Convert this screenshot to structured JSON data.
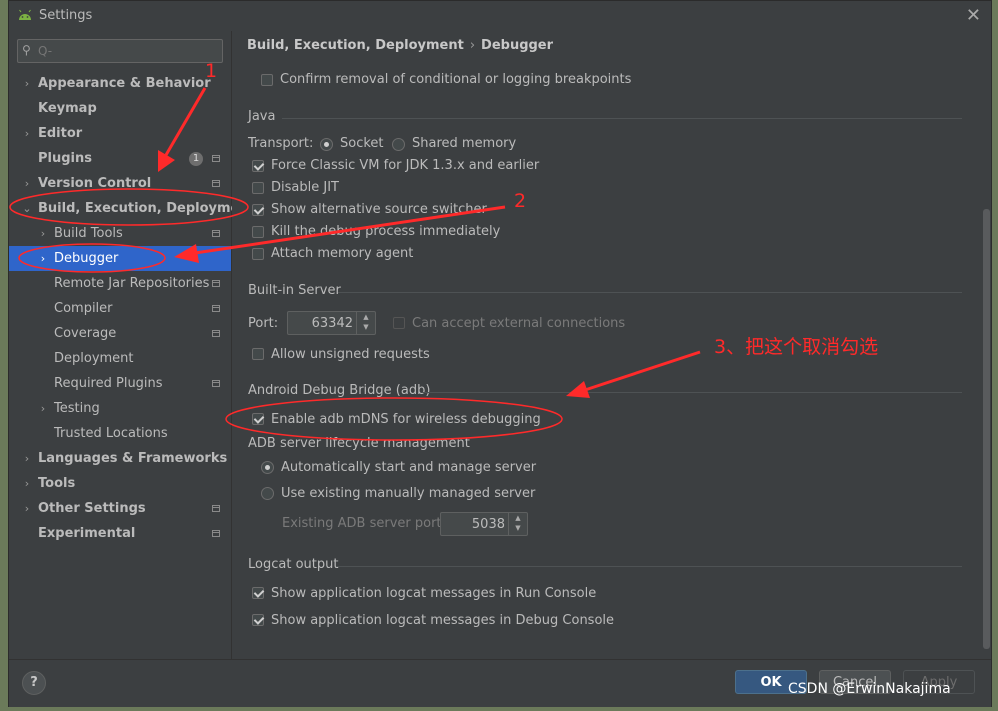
{
  "window": {
    "title": "Settings"
  },
  "search": {
    "placeholder": "Q-"
  },
  "sidebar": {
    "items": [
      {
        "label": "Appearance & Behavior",
        "arrow": "›",
        "bold": true
      },
      {
        "label": "Keymap",
        "bold": true
      },
      {
        "label": "Editor",
        "arrow": "›",
        "bold": true
      },
      {
        "label": "Plugins",
        "bold": true,
        "badge": "1"
      },
      {
        "label": "Version Control",
        "arrow": "›",
        "bold": true
      },
      {
        "label": "Build, Execution, Deployment",
        "arrow": "⌄",
        "bold": true
      },
      {
        "label": "Build Tools",
        "arrow": "›"
      },
      {
        "label": "Debugger",
        "arrow": "›",
        "selected": true
      },
      {
        "label": "Remote Jar Repositories"
      },
      {
        "label": "Compiler"
      },
      {
        "label": "Coverage"
      },
      {
        "label": "Deployment"
      },
      {
        "label": "Required Plugins"
      },
      {
        "label": "Testing",
        "arrow": "›"
      },
      {
        "label": "Trusted Locations"
      },
      {
        "label": "Languages & Frameworks",
        "arrow": "›",
        "bold": true
      },
      {
        "label": "Tools",
        "arrow": "›",
        "bold": true
      },
      {
        "label": "Other Settings",
        "arrow": "›",
        "bold": true
      },
      {
        "label": "Experimental",
        "bold": true
      }
    ]
  },
  "breadcrumb": {
    "parent": "Build, Execution, Deployment",
    "sep": "›",
    "current": "Debugger"
  },
  "main": {
    "confirm_removal": "Confirm removal of conditional or logging breakpoints",
    "java": {
      "title": "Java",
      "transport_label": "Transport:",
      "socket": "Socket",
      "shared_memory": "Shared memory",
      "force_classic": "Force Classic VM for JDK 1.3.x and earlier",
      "disable_jit": "Disable JIT",
      "show_alt": "Show alternative source switcher",
      "kill_debug": "Kill the debug process immediately",
      "attach_agent": "Attach memory agent"
    },
    "builtin": {
      "title": "Built-in Server",
      "port_label": "Port:",
      "port_value": "63342",
      "external": "Can accept external connections",
      "unsigned": "Allow unsigned requests"
    },
    "adb": {
      "title": "Android Debug Bridge (adb)",
      "mdns": "Enable adb mDNS for wireless debugging",
      "lifecycle": "ADB server lifecycle management",
      "auto": "Automatically start and manage server",
      "existing": "Use existing manually managed server",
      "port_label": "Existing ADB server port:",
      "port_value": "5038"
    },
    "logcat": {
      "title": "Logcat output",
      "run": "Show application logcat messages in Run Console",
      "debug": "Show application logcat messages in Debug Console"
    }
  },
  "footer": {
    "help": "?",
    "ok": "OK",
    "cancel": "Cancel",
    "apply": "Apply"
  },
  "annotations": {
    "one": "1",
    "two": "2",
    "three": "3、把这个取消勾选"
  },
  "watermark": "CSDN @ErwinNakajima",
  "colors": {
    "selection": "#2f65ca",
    "annotation": "#ff2a2a",
    "ok_button": "#365880"
  }
}
